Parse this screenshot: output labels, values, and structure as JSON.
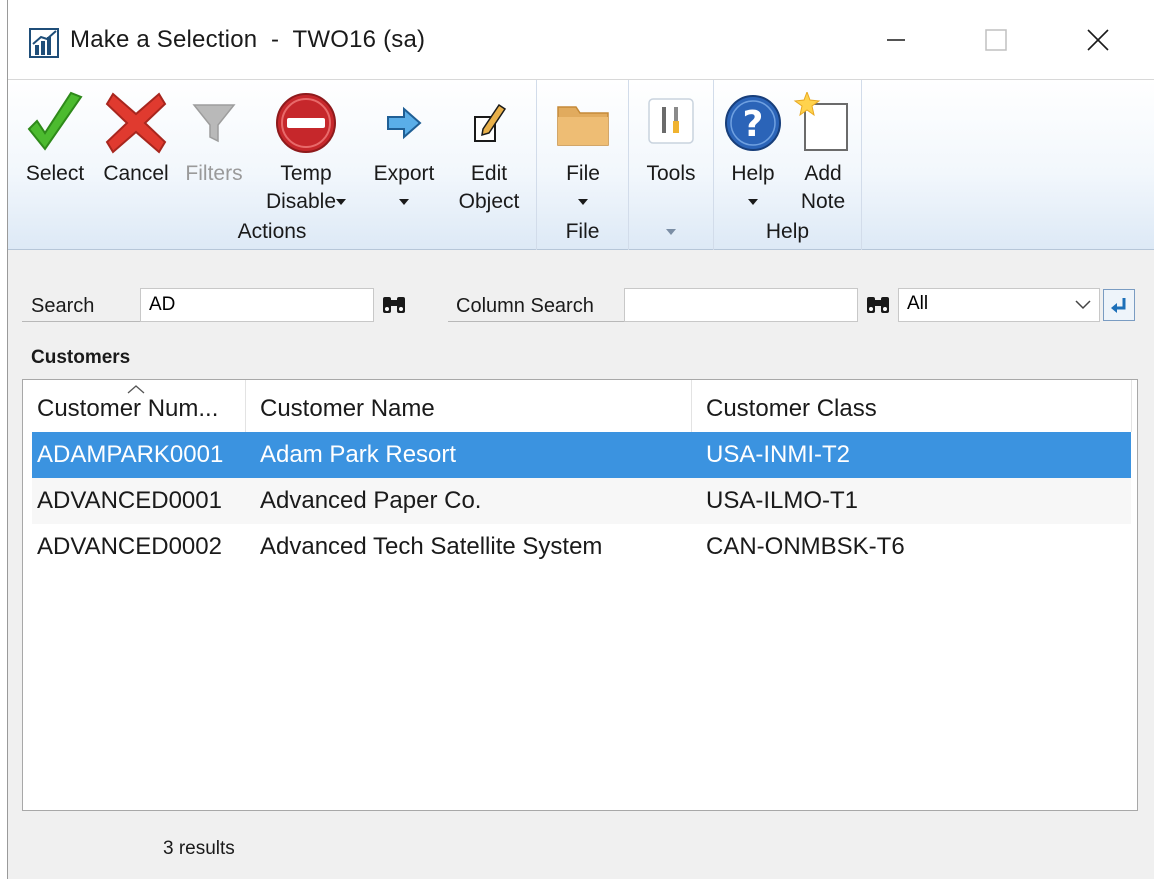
{
  "window": {
    "title": "Make a Selection  -  TWO16 (sa)"
  },
  "ribbon": {
    "groups": {
      "actions": {
        "label": "Actions",
        "select": "Select",
        "cancel": "Cancel",
        "filters": "Filters",
        "temp_disable_1": "Temp",
        "temp_disable_2": "Disable",
        "export": "Export",
        "edit_object_1": "Edit",
        "edit_object_2": "Object"
      },
      "file": {
        "label": "File",
        "file": "File"
      },
      "tools": {
        "tools": "Tools"
      },
      "help": {
        "label": "Help",
        "help": "Help",
        "add_note_1": "Add",
        "add_note_2": "Note"
      }
    }
  },
  "search": {
    "label": "Search",
    "value": "AD",
    "column_search_label": "Column Search",
    "column_search_value": "",
    "column_select": "All"
  },
  "list": {
    "title": "Customers",
    "columns": [
      "Customer Num...",
      "Customer Name",
      "Customer Class"
    ],
    "rows": [
      [
        "ADAMPARK0001",
        "Adam Park Resort",
        "USA-INMI-T2"
      ],
      [
        "ADVANCED0001",
        "Advanced Paper Co.",
        "USA-ILMO-T1"
      ],
      [
        "ADVANCED0002",
        "Advanced Tech Satellite System",
        "CAN-ONMBSK-T6"
      ]
    ],
    "selected_row": 0
  },
  "status": {
    "results": "3 results"
  },
  "colors": {
    "selection": "#3b93e0",
    "ribbon_bottom": "#dde9f6"
  }
}
